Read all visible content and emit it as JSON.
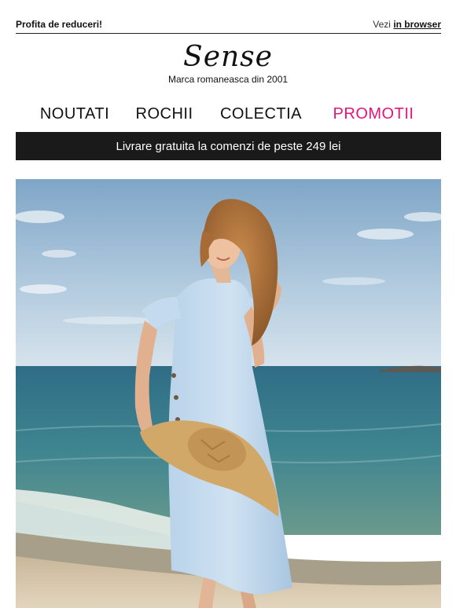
{
  "header": {
    "promo_text": "Profita de reduceri!",
    "view_prefix": "Vezi",
    "view_link": "in browser"
  },
  "brand": {
    "logo": "Sense",
    "tagline": "Marca romaneasca din 2001"
  },
  "nav": {
    "items": [
      {
        "label": "NOUTATI"
      },
      {
        "label": "ROCHII"
      },
      {
        "label": "COLECTIA"
      },
      {
        "label": "PROMOTII"
      }
    ],
    "highlight_color": "#e2157b"
  },
  "banner": {
    "text": "Livrare gratuita la comenzi de peste 249 lei"
  }
}
